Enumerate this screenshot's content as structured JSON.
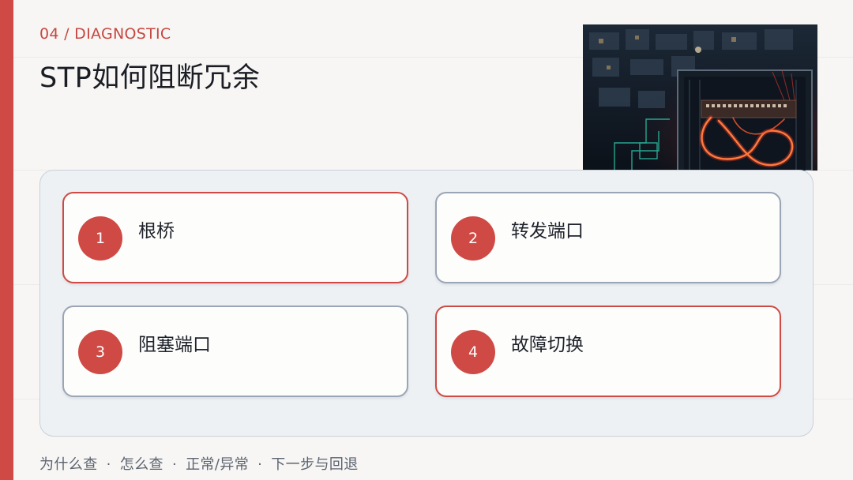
{
  "header": {
    "section_tag": "04 / DIAGNOSTIC",
    "title": "STP如何阻断冗余"
  },
  "hero_image": {
    "subject": "network-switch-illustration"
  },
  "cards": [
    {
      "number": "1",
      "label": "根桥",
      "accent": true
    },
    {
      "number": "2",
      "label": "转发端口",
      "accent": false
    },
    {
      "number": "3",
      "label": "阻塞端口",
      "accent": false
    },
    {
      "number": "4",
      "label": "故障切换",
      "accent": true
    }
  ],
  "footer": {
    "items": [
      "为什么查",
      "怎么查",
      "正常/异常",
      "下一步与回退"
    ],
    "separator": "·"
  },
  "colors": {
    "accent": "#cf4a44",
    "card_border": "#9aa6b5",
    "panel_bg": "#eef1f4",
    "page_bg": "#f7f6f4"
  }
}
